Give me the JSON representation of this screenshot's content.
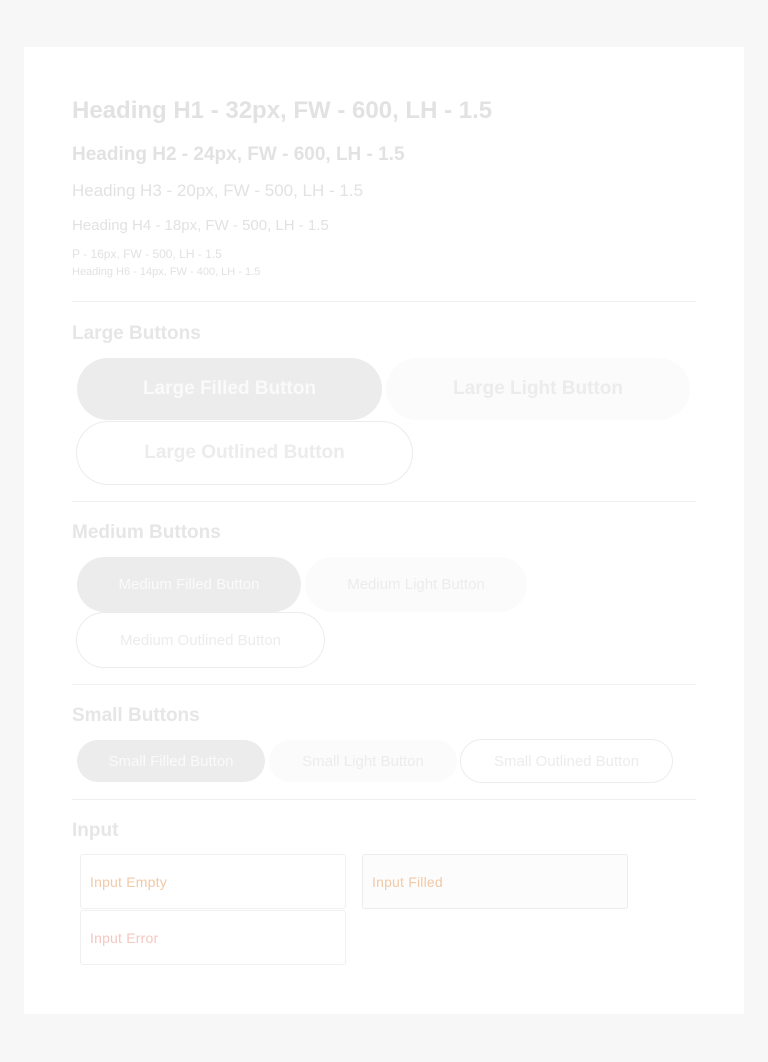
{
  "typography": {
    "h1": "Heading H1 - 32px, FW - 600, LH - 1.5",
    "h2": "Heading H2 - 24px, FW - 600, LH - 1.5",
    "h3": "Heading H3 - 20px, FW - 500, LH - 1.5",
    "h4": "Heading H4 - 18px, FW - 500, LH - 1.5",
    "p": "P - 16px, FW - 500, LH - 1.5",
    "h6": "Heading H6 - 14px, FW - 400, LH - 1.5"
  },
  "large_buttons": {
    "title": "Large Buttons",
    "filled": "Large Filled Button",
    "light": "Large Light Button",
    "outlined": "Large Outlined Button"
  },
  "medium_buttons": {
    "title": "Medium Buttons",
    "filled": "Medium Filled Button",
    "light": "Medium Light Button",
    "outlined": "Medium Outlined Button"
  },
  "small_buttons": {
    "title": "Small Buttons",
    "filled": "Small Filled Button",
    "light": "Small Light Button",
    "outlined": "Small Outlined Button"
  },
  "input_section": {
    "title": "Input",
    "empty": "Input Empty",
    "filled": "Input Filled",
    "error": "Input Error"
  },
  "colors": {
    "page_background": "#f7f7f7",
    "card_background": "#ffffff",
    "filled_button": "#ececec",
    "light_button": "#fbfbfb",
    "text_faded": "#e2e2e2"
  }
}
